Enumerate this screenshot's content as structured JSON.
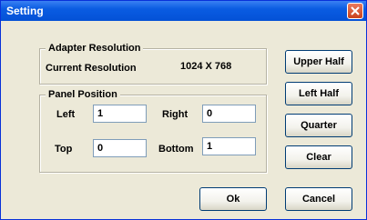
{
  "window": {
    "title": "Setting"
  },
  "adapter_resolution": {
    "caption": "Adapter Resolution",
    "current_label": "Current Resolution",
    "current_value": "1024 X 768"
  },
  "panel_position": {
    "caption": "Panel Position",
    "left_label": "Left",
    "left_value": "1",
    "right_label": "Right",
    "right_value": "0",
    "top_label": "Top",
    "top_value": "0",
    "bottom_label": "Bottom",
    "bottom_value": "1"
  },
  "buttons": {
    "upper_half": "Upper Half",
    "left_half": "Left Half",
    "quarter": "Quarter",
    "clear": "Clear",
    "ok": "Ok",
    "cancel": "Cancel"
  }
}
